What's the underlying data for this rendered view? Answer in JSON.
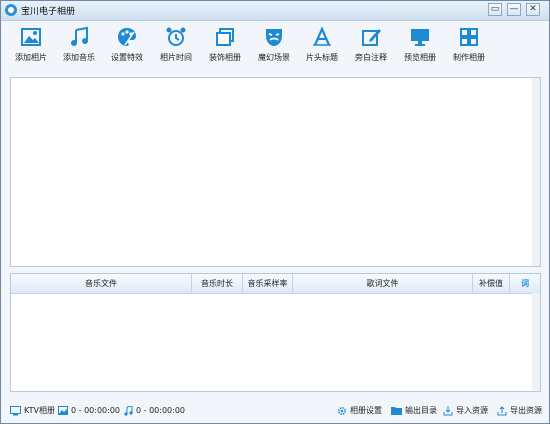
{
  "window": {
    "title": "宝川电子相册"
  },
  "titlebar_buttons": [
    "▭",
    "—",
    "✕"
  ],
  "toolbar": [
    {
      "label": "添加相片",
      "icon": "add-photo-icon"
    },
    {
      "label": "添加音乐",
      "icon": "music-note-icon"
    },
    {
      "label": "设置特效",
      "icon": "palette-icon"
    },
    {
      "label": "相片时间",
      "icon": "alarm-clock-icon"
    },
    {
      "label": "装饰相册",
      "icon": "stacked-frames-icon"
    },
    {
      "label": "魔幻场景",
      "icon": "theater-mask-icon"
    },
    {
      "label": "片头标题",
      "icon": "title-letter-icon"
    },
    {
      "label": "旁白注释",
      "icon": "edit-pen-icon"
    },
    {
      "label": "预览相册",
      "icon": "monitor-icon"
    },
    {
      "label": "制作相册",
      "icon": "grid-icon"
    }
  ],
  "music_table": {
    "columns": [
      "音乐文件",
      "音乐时长",
      "音乐采样率",
      "歌词文件",
      "补偿值",
      "词"
    ]
  },
  "status": {
    "ktv": "KTV相册",
    "photo_count": "0 - 00:00:00",
    "music_count": "0 - 00:00:00",
    "album_settings": "相册设置",
    "output_dir": "输出目录",
    "import": "导入资源",
    "export": "导出资源"
  },
  "colors": {
    "accent": "#1e8ad6",
    "header_bg": "#dfeaf6"
  }
}
